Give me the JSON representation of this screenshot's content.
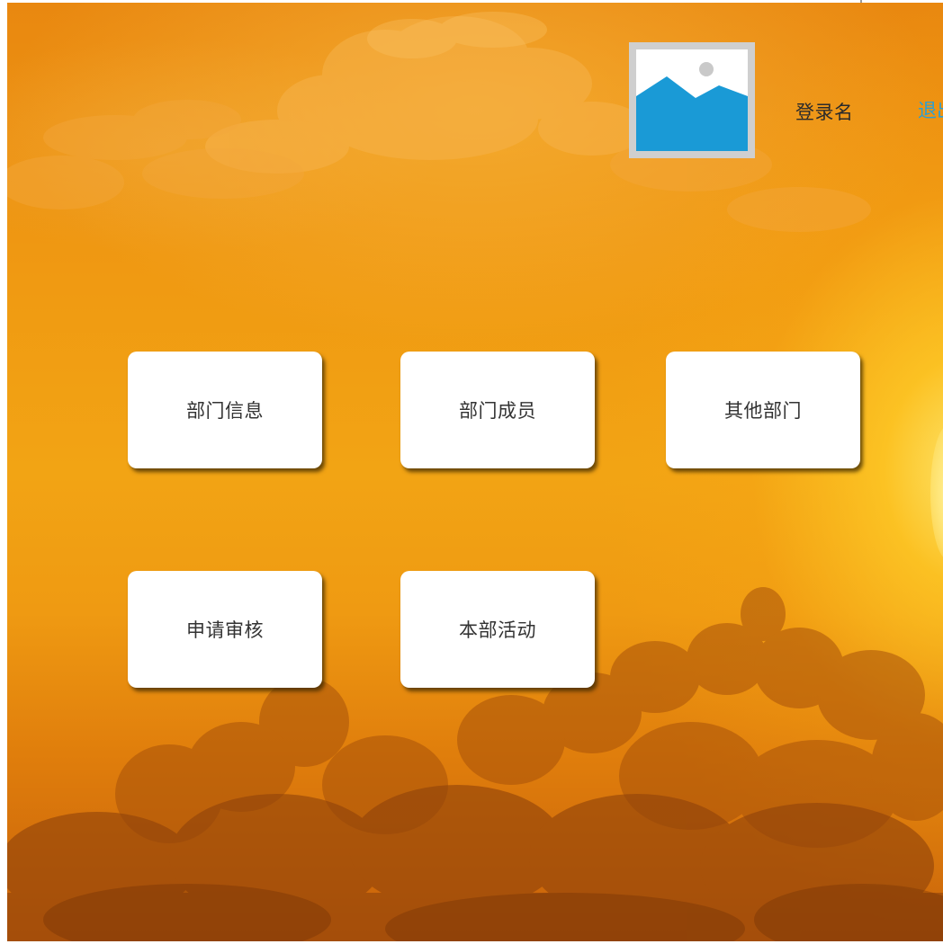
{
  "header": {
    "login_name": "登录名",
    "logout_label": "退出"
  },
  "avatar": {
    "icon": "image-placeholder-icon",
    "colors": {
      "frame": "#cfcfcf",
      "mountain": "#1a9ad6",
      "sun": "#c9c9c9"
    }
  },
  "menu": {
    "items": [
      {
        "label": "部门信息"
      },
      {
        "label": "部门成员"
      },
      {
        "label": "其他部门"
      },
      {
        "label": "申请审核"
      },
      {
        "label": "本部活动"
      }
    ]
  },
  "colors": {
    "accent": "#2a9fd6",
    "background_top": "#e98810",
    "background_bottom": "#c7610a",
    "card": "#ffffff",
    "text": "#333333"
  }
}
